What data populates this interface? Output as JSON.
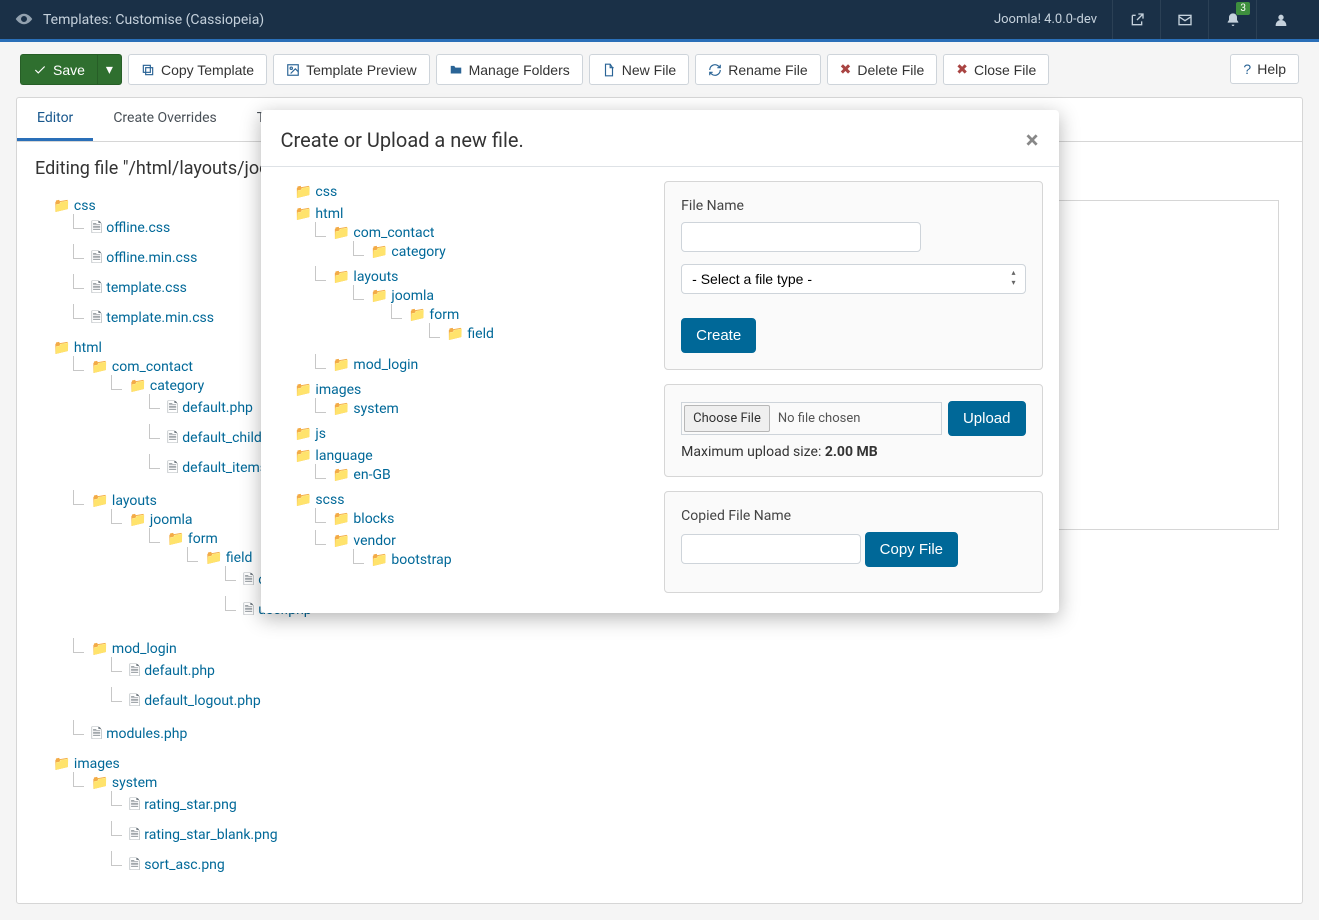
{
  "header": {
    "title": "Templates: Customise (Cassiopeia)",
    "version": "Joomla! 4.0.0-dev",
    "notif_count": "3"
  },
  "toolbar": {
    "save": "Save",
    "copy_template": "Copy Template",
    "template_preview": "Template Preview",
    "manage_folders": "Manage Folders",
    "new_file": "New File",
    "rename_file": "Rename File",
    "delete_file": "Delete File",
    "close_file": "Close File",
    "help": "Help"
  },
  "tabs": {
    "editor": "Editor",
    "overrides": "Create Overrides",
    "templ": "Tem"
  },
  "editing": "Editing file \"/html/layouts/joom",
  "sidebar": {
    "css": {
      "label": "css",
      "files": [
        "offline.css",
        "offline.min.css",
        "template.css",
        "template.min.css"
      ]
    },
    "html": {
      "label": "html",
      "com_contact": {
        "label": "com_contact",
        "category": {
          "label": "category",
          "files": [
            "default.php",
            "default_children.php",
            "default_items.php"
          ]
        }
      },
      "layouts": {
        "label": "layouts",
        "joomla": {
          "label": "joomla",
          "form": {
            "label": "form",
            "field": {
              "label": "field",
              "files": [
                "contenthistory.ph",
                "user.php"
              ]
            }
          }
        }
      },
      "mod_login": {
        "label": "mod_login",
        "files": [
          "default.php",
          "default_logout.php"
        ]
      },
      "modules": "modules.php"
    },
    "images": {
      "label": "images",
      "system": {
        "label": "system",
        "files": [
          "rating_star.png",
          "rating_star_blank.png",
          "sort_asc.png"
        ]
      }
    }
  },
  "modal": {
    "title": "Create or Upload a new file.",
    "tree": {
      "css": "css",
      "html": "html",
      "com_contact": "com_contact",
      "category": "category",
      "layouts": "layouts",
      "joomla": "joomla",
      "form": "form",
      "field": "field",
      "mod_login": "mod_login",
      "images": "images",
      "system": "system",
      "js": "js",
      "language": "language",
      "enGB": "en-GB",
      "scss": "scss",
      "blocks": "blocks",
      "vendor": "vendor",
      "bootstrap": "bootstrap"
    },
    "create": {
      "file_name_label": "File Name",
      "select_placeholder": "- Select a file type -",
      "create_btn": "Create"
    },
    "upload": {
      "choose": "Choose File",
      "no_file": "No file chosen",
      "upload_btn": "Upload",
      "max_label": "Maximum upload size: ",
      "max_val": "2.00 MB"
    },
    "copy": {
      "label": "Copied File Name",
      "btn": "Copy File"
    }
  }
}
